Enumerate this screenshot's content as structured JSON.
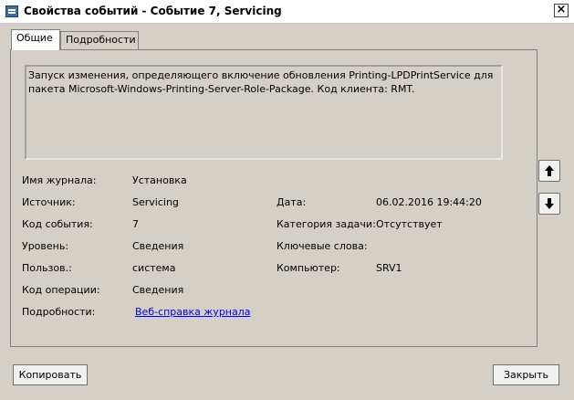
{
  "window": {
    "title": "Свойства событий - Событие 7, Servicing",
    "close_glyph": "×"
  },
  "tabs": [
    {
      "label": "Общие"
    },
    {
      "label": "Подробности"
    }
  ],
  "description": "Запуск изменения, определяющего включение обновления Printing-LPDPrintService для пакета Microsoft-Windows-Printing-Server-Role-Package. Код клиента: RMT.",
  "fields": {
    "log_name": {
      "label": "Имя журнала:",
      "value": "Установка"
    },
    "source": {
      "label": "Источник:",
      "value": "Servicing"
    },
    "date": {
      "label": "Дата:",
      "value": "06.02.2016 19:44:20"
    },
    "event_id": {
      "label": "Код события:",
      "value": "7"
    },
    "task_category": {
      "label": "Категория задачи:",
      "value": "Отсутствует"
    },
    "level": {
      "label": "Уровень:",
      "value": "Сведения"
    },
    "keywords": {
      "label": "Ключевые слова:",
      "value": ""
    },
    "user": {
      "label": "Пользов.:",
      "value": "система"
    },
    "computer": {
      "label": "Компьютер:",
      "value": "SRV1"
    },
    "opcode": {
      "label": "Код операции:",
      "value": "Сведения"
    },
    "more_info": {
      "label": "Подробности:",
      "value": "Веб-справка журнала"
    }
  },
  "nav": {
    "up_icon": "arrow-up-icon",
    "down_icon": "arrow-down-icon"
  },
  "buttons": {
    "copy": "Копировать",
    "close": "Закрыть"
  }
}
